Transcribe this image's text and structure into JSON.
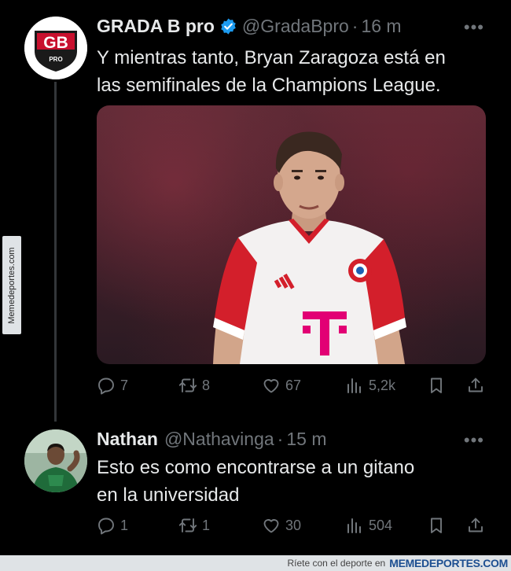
{
  "watermark": {
    "side_text": "Memedeportes.com",
    "bottom_text": "Ríete con el deporte en",
    "bottom_brand": "MEMEDEPORTES.COM"
  },
  "tweet1": {
    "avatar_text": "GB",
    "avatar_subtext": "PRO",
    "name": "GRADA B pro",
    "handle": "@GradaBpro",
    "separator": "·",
    "time": "16 m",
    "more": "•••",
    "text_line1": "Y mientras tanto, Bryan Zaragoza está en",
    "text_line2": "las semifinales de la Champions League.",
    "replies": "7",
    "reposts": "8",
    "likes": "67",
    "views": "5,2k"
  },
  "tweet2": {
    "name": "Nathan",
    "handle": "@Nathavinga",
    "separator": "·",
    "time": "15 m",
    "more": "•••",
    "text_line1": "Esto es como encontrarse a un gitano",
    "text_line2": "en la universidad",
    "replies": "1",
    "reposts": "1",
    "likes": "30",
    "views": "504"
  },
  "colors": {
    "background": "#000000",
    "text": "#e7e9ea",
    "muted": "#71767b",
    "verified": "#1d9bf0",
    "gb_red": "#c8102e"
  }
}
